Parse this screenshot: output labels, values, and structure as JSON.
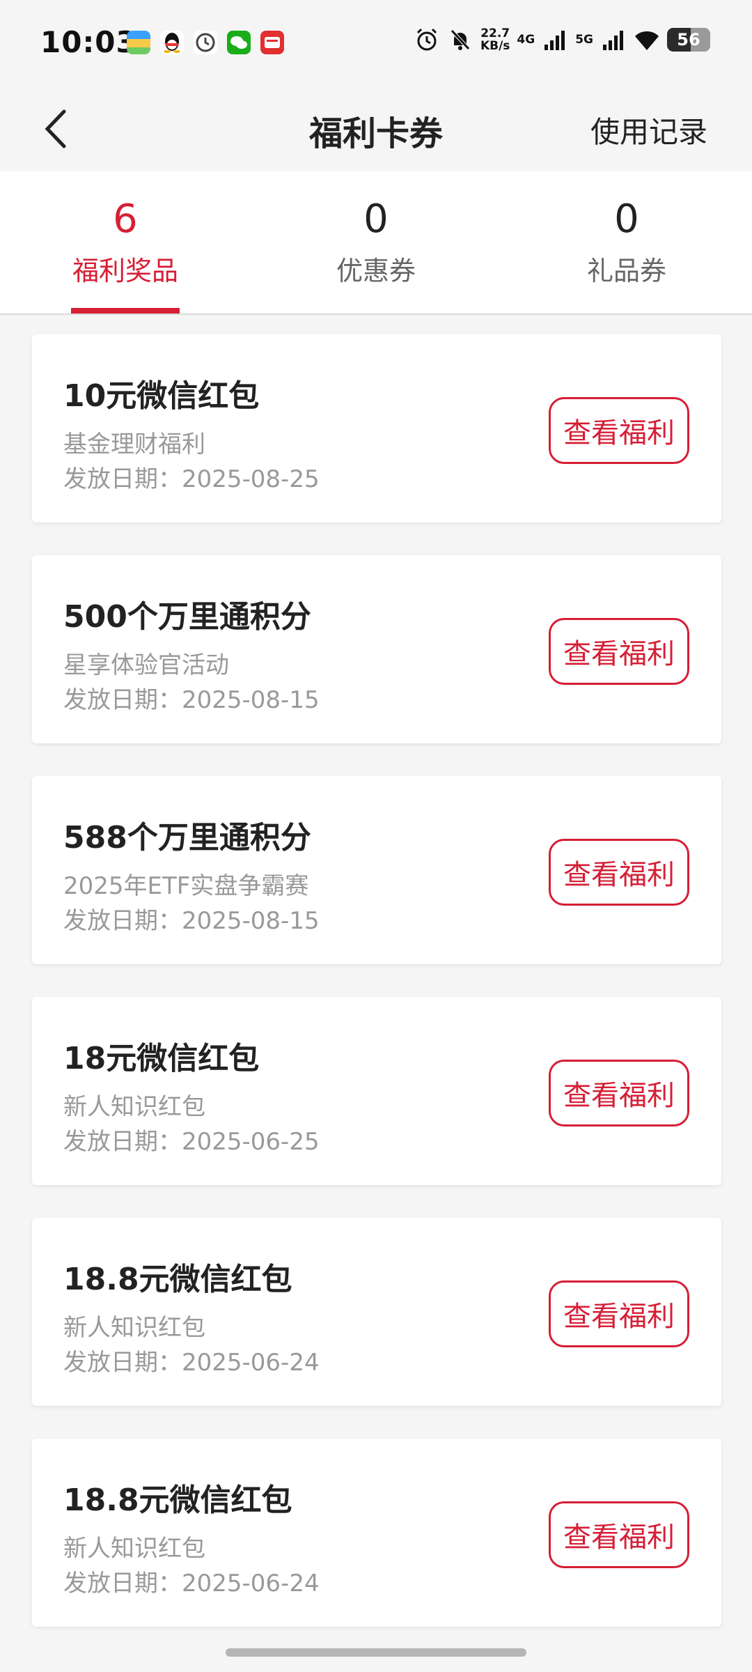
{
  "status_bar": {
    "time": "10:03",
    "speed_value": "22.7",
    "speed_unit": "KB/s",
    "net1": "4G",
    "net2": "5G",
    "battery": "56",
    "apps": [
      "wallet-app-icon",
      "qq-app-icon",
      "clock-app-icon",
      "wechat-app-icon",
      "red-app-icon"
    ]
  },
  "nav": {
    "title": "福利卡券",
    "right_label": "使用记录"
  },
  "tabs": [
    {
      "count": "6",
      "label": "福利奖品",
      "active": true
    },
    {
      "count": "0",
      "label": "优惠券",
      "active": false
    },
    {
      "count": "0",
      "label": "礼品券",
      "active": false
    }
  ],
  "cards": [
    {
      "title": "10元微信红包",
      "subtitle": "基金理财福利",
      "date": "发放日期：2025-08-25",
      "button": "查看福利"
    },
    {
      "title": "500个万里通积分",
      "subtitle": "星享体验官活动",
      "date": "发放日期：2025-08-15",
      "button": "查看福利"
    },
    {
      "title": "588个万里通积分",
      "subtitle": "2025年ETF实盘争霸赛",
      "date": "发放日期：2025-08-15",
      "button": "查看福利"
    },
    {
      "title": "18元微信红包",
      "subtitle": "新人知识红包",
      "date": "发放日期：2025-06-25",
      "button": "查看福利"
    },
    {
      "title": "18.8元微信红包",
      "subtitle": "新人知识红包",
      "date": "发放日期：2025-06-24",
      "button": "查看福利"
    },
    {
      "title": "18.8元微信红包",
      "subtitle": "新人知识红包",
      "date": "发放日期：2025-06-24",
      "button": "查看福利"
    }
  ],
  "colors": {
    "accent": "#d61e35",
    "background": "#f5f5f5",
    "card": "#ffffff",
    "muted_text": "#999999"
  }
}
